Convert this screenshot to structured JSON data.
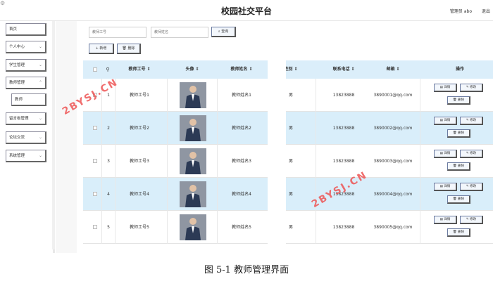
{
  "header": {
    "title": "校园社交平台",
    "user": "管理员 abo",
    "logout": "退出"
  },
  "sidebar": {
    "items": [
      {
        "label": "首页",
        "has_arrow": false
      },
      {
        "label": "个人中心",
        "has_arrow": true
      },
      {
        "label": "学生管理",
        "has_arrow": true
      },
      {
        "label": "教师管理",
        "has_arrow": true
      },
      {
        "label": "教师",
        "has_arrow": false,
        "sub": true
      },
      {
        "label": "留言板管理",
        "has_arrow": true
      },
      {
        "label": "论坛交流",
        "has_arrow": true
      },
      {
        "label": "系统管理",
        "has_arrow": true
      }
    ]
  },
  "search": {
    "placeholder_no": "教师工号",
    "placeholder_name": "教师姓名",
    "search_button": "查询"
  },
  "toolbar": {
    "add_label": "+ 新增",
    "delete_label": "删除"
  },
  "table": {
    "columns": [
      "教师工号 ⇕",
      "头像 ⇕",
      "教师姓名 ⇕",
      "性别 ⇕",
      "联系电话 ⇕",
      "邮箱 ⇕",
      "操作"
    ],
    "rows": [
      {
        "index": "1",
        "no": "教师工号1",
        "name": "教师姓名1",
        "gender": "男",
        "phone": "13823888",
        "email": "3890001@qq.com"
      },
      {
        "index": "2",
        "no": "教师工号2",
        "name": "教师姓名2",
        "gender": "男",
        "phone": "13823888",
        "email": "3890002@qq.com"
      },
      {
        "index": "3",
        "no": "教师工号3",
        "name": "教师姓名3",
        "gender": "男",
        "phone": "13823888",
        "email": "3890003@qq.com"
      },
      {
        "index": "4",
        "no": "教师工号4",
        "name": "教师姓名4",
        "gender": "男",
        "phone": "13823888",
        "email": "3890004@qq.com"
      },
      {
        "index": "5",
        "no": "教师工号5",
        "name": "教师姓名5",
        "gender": "男",
        "phone": "13823888",
        "email": "3890005@qq.com"
      }
    ],
    "actions": {
      "detail": "详情",
      "edit": "修改",
      "delete": "删除"
    }
  },
  "watermark": "2BYSJ.CN",
  "caption": "图 5-1  教师管理界面"
}
